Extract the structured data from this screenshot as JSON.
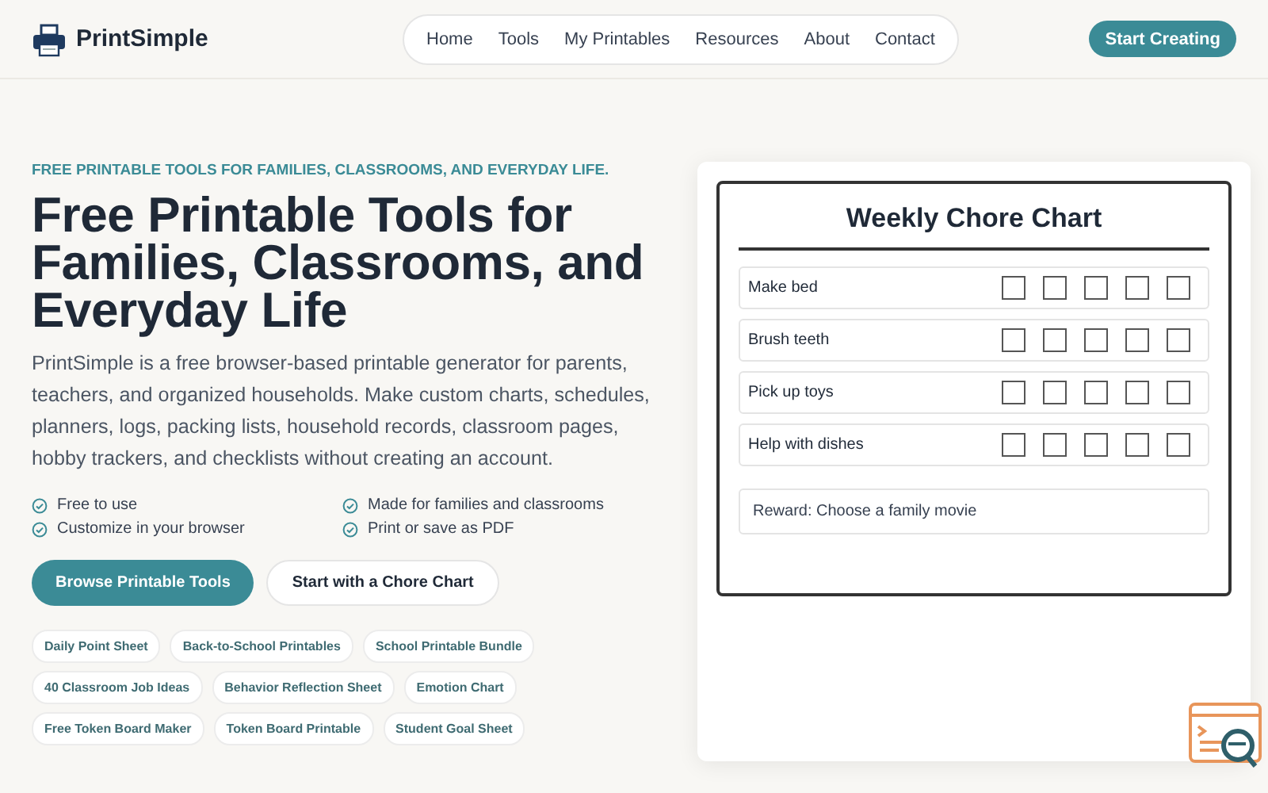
{
  "header": {
    "brand": "PrintSimple",
    "nav": [
      {
        "label": "Home",
        "selected": false
      },
      {
        "label": "Tools",
        "selected": false
      },
      {
        "label": "My Printables",
        "selected": false
      },
      {
        "label": "Resources",
        "selected": false
      },
      {
        "label": "About",
        "selected": false
      },
      {
        "label": "Contact",
        "selected": false
      }
    ],
    "cta": "Start Creating"
  },
  "hero": {
    "eyebrow": "FREE PRINTABLE TOOLS FOR FAMILIES, CLASSROOMS, AND EVERYDAY LIFE.",
    "title": "Free Printable Tools for Families, Classrooms, and Everyday Life",
    "description": "PrintSimple is a free browser-based printable generator for parents, teachers, and organized households. Make custom charts, schedules, planners, logs, packing lists, household records, classroom pages, hobby trackers, and checklists without creating an account.",
    "features": [
      "Free to use",
      "Made for families and classrooms",
      "Customize in your browser",
      "Print or save as PDF"
    ],
    "buttons": [
      {
        "label": "Browse Printable Tools",
        "kind": "primary"
      },
      {
        "label": "Start with a Chore Chart",
        "kind": "secondary"
      }
    ],
    "links": [
      "Daily Point Sheet",
      "Back-to-School Printables",
      "School Printable Bundle",
      "40 Classroom Job Ideas",
      "Behavior Reflection Sheet",
      "Emotion Chart",
      "Free Token Board Maker",
      "Token Board Printable",
      "Student Goal Sheet"
    ]
  },
  "preview": {
    "title": "Weekly Chore Chart",
    "chores": [
      {
        "name": "Make bed",
        "boxes": [
          {
            "checked": false
          },
          {
            "checked": false
          },
          {
            "checked": false
          },
          {
            "checked": false
          },
          {
            "checked": false
          }
        ]
      },
      {
        "name": "Brush teeth",
        "boxes": [
          {
            "checked": false
          },
          {
            "checked": false
          },
          {
            "checked": false
          },
          {
            "checked": false
          },
          {
            "checked": false
          }
        ]
      },
      {
        "name": "Pick up toys",
        "boxes": [
          {
            "checked": false
          },
          {
            "checked": false
          },
          {
            "checked": false
          },
          {
            "checked": false
          },
          {
            "checked": false
          }
        ]
      },
      {
        "name": "Help with dishes",
        "boxes": [
          {
            "checked": false
          },
          {
            "checked": false
          },
          {
            "checked": false
          },
          {
            "checked": false
          },
          {
            "checked": false
          }
        ]
      }
    ],
    "reward": "Reward: Choose a family movie"
  }
}
